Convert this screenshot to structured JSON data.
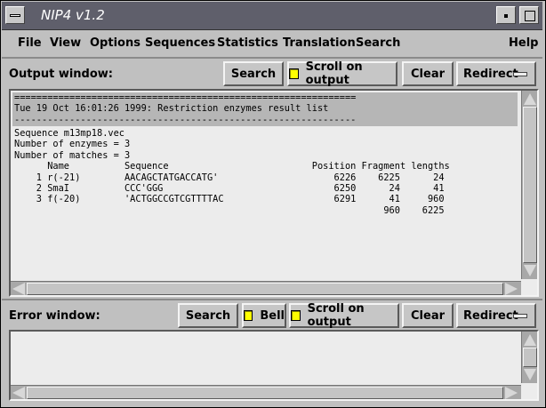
{
  "window": {
    "title": "NIP4 v1.2"
  },
  "menu": [
    "File",
    "View",
    "Options",
    "Sequences",
    "Statistics",
    "Translation",
    "Search",
    "Help"
  ],
  "output": {
    "label": "Output window:",
    "search": "Search",
    "scroll_on_output": "Scroll on output",
    "clear": "Clear",
    "redirect": "Redirect",
    "lines": [
      "==============================================================",
      "Tue 19 Oct 16:01:26 1999: Restriction enzymes result list",
      "--------------------------------------------------------------",
      "Sequence m13mp18.vec",
      "Number of enzymes = 3",
      "Number of matches = 3",
      "      Name          Sequence                          Position Fragment lengths",
      "    1 r(-21)        AACAGCTATGACCATG'                     6226    6225      24",
      "    2 SmaI          CCC'GGG                               6250      24      41",
      "    3 f(-20)        'ACTGGCCGTCGTTTTAC                    6291      41     960",
      "                                                                   960    6225"
    ]
  },
  "error": {
    "label": "Error window:",
    "search": "Search",
    "bell": "Bell",
    "scroll_on_output": "Scroll on output",
    "clear": "Clear",
    "redirect": "Redirect"
  },
  "colors": {
    "checkbox": "#ffff00",
    "titlebar": "#5f5f6b",
    "pane": "#ececec"
  }
}
